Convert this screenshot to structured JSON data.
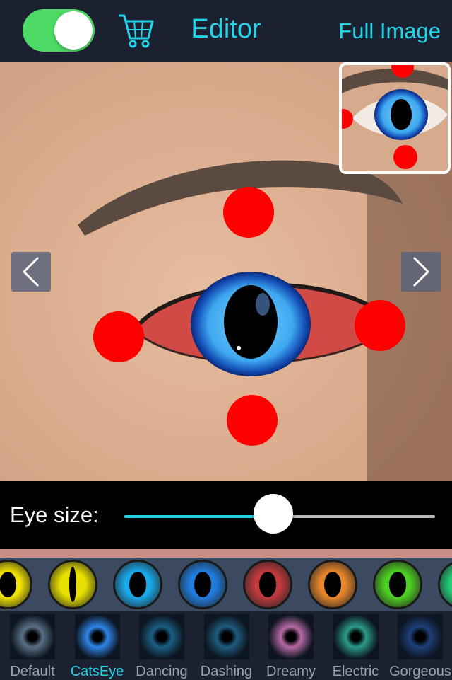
{
  "header": {
    "toggle_on": true,
    "cart_icon": "cart-icon",
    "title": "Editor",
    "full_image_label": "Full Image"
  },
  "editor": {
    "prev_icon": "chevron-left-icon",
    "next_icon": "chevron-right-icon",
    "handles": [
      "top",
      "left",
      "right",
      "bottom"
    ]
  },
  "eye_size": {
    "label": "Eye size:",
    "value": 0.48
  },
  "lens_colors": [
    "#f3e400",
    "#e8e000",
    "#19a9ec",
    "#1f7de0",
    "#c23a3e",
    "#e8862a",
    "#4ecf22",
    "#20d07a"
  ],
  "styles": {
    "selected": "CatsEye",
    "items": [
      {
        "label": "Default",
        "color": "#5a7188"
      },
      {
        "label": "CatsEye",
        "color": "#2f86e8"
      },
      {
        "label": "Dancing",
        "color": "#1c5f86"
      },
      {
        "label": "Dashing",
        "color": "#1e5c7e"
      },
      {
        "label": "Dreamy",
        "color": "#b86aa6"
      },
      {
        "label": "Electric",
        "color": "#2b9b8a"
      },
      {
        "label": "Gorgeous",
        "color": "#1d3f7a"
      }
    ]
  },
  "colors": {
    "accent": "#21d4e6",
    "toggle": "#4cd964",
    "handle": "#ff0000"
  }
}
